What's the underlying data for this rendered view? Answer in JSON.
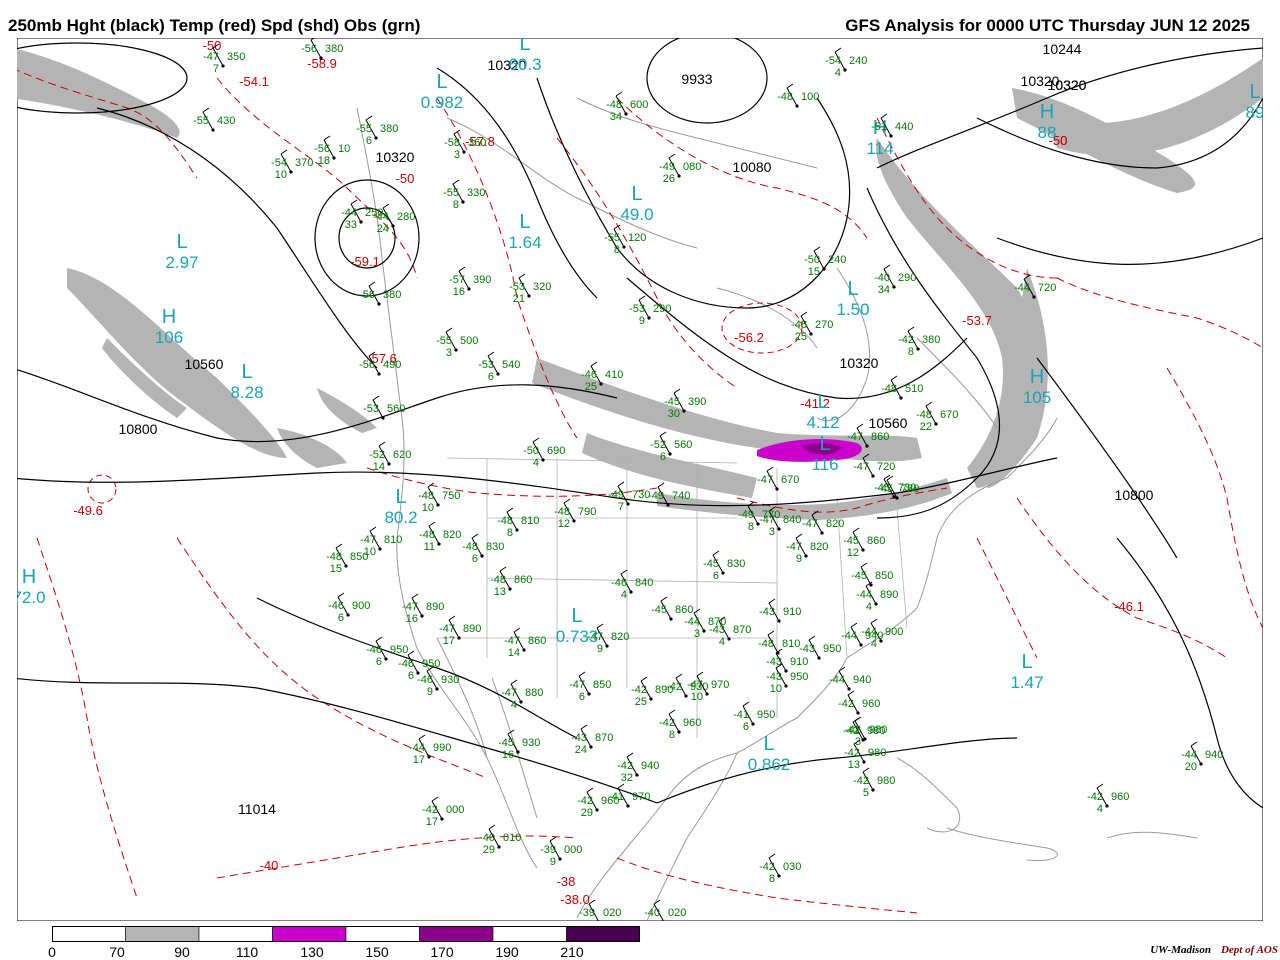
{
  "header": {
    "left_title": "250mb Hght (black) Temp (red) Spd (shd) Obs (grn)",
    "right_title": "GFS Analysis for 0000 UTC Thursday  JUN 12 2025"
  },
  "credit": {
    "org": "UW-Madison",
    "dept": "Dept of AOS"
  },
  "colors": {
    "height": "#000000",
    "temp": "#cc0000",
    "speed_70": "#b4b4b4",
    "speed_110": "#cc00cc",
    "speed_150": "#8a008a",
    "speed_190": "#4a0050",
    "obs": "#007a00",
    "center": "#1aa3b8"
  },
  "colorbar": {
    "ticks": [
      "0",
      "70",
      "90",
      "110",
      "130",
      "150",
      "170",
      "190",
      "210"
    ],
    "bins": [
      {
        "from": 0,
        "to": 70,
        "color": "#ffffff"
      },
      {
        "from": 70,
        "to": 90,
        "color": "#b4b4b4"
      },
      {
        "from": 90,
        "to": 110,
        "color": "#ffffff"
      },
      {
        "from": 110,
        "to": 130,
        "color": "#cc00cc"
      },
      {
        "from": 130,
        "to": 150,
        "color": "#ffffff"
      },
      {
        "from": 150,
        "to": 170,
        "color": "#8a008a"
      },
      {
        "from": 170,
        "to": 190,
        "color": "#ffffff"
      },
      {
        "from": 190,
        "to": 210,
        "color": "#4a0050"
      }
    ]
  },
  "height_labels": [
    "10320",
    "10320",
    "10080",
    "10320",
    "10560",
    "10800",
    "10560",
    "10800",
    "10320",
    "10244",
    "10320",
    "10320",
    "11014",
    "9933"
  ],
  "temp_labels": [
    "-50",
    "-58.9",
    "-57.8",
    "-50",
    "-59.1",
    "-57.6",
    "-54.1",
    "-56.2",
    "-41.2",
    "-49.6",
    "-46.1",
    "-40",
    "-38",
    "-50",
    "-50",
    "-53.7",
    "-38.0"
  ],
  "centers": [
    {
      "type": "L",
      "value": "0.982"
    },
    {
      "type": "L",
      "value": "1.64"
    },
    {
      "type": "L",
      "value": "2.97"
    },
    {
      "type": "H",
      "value": "106"
    },
    {
      "type": "L",
      "value": "8.28"
    },
    {
      "type": "L",
      "value": "1.50"
    },
    {
      "type": "H",
      "value": "114"
    },
    {
      "type": "L",
      "value": "0.733"
    },
    {
      "type": "L",
      "value": "0.862"
    },
    {
      "type": "L",
      "value": "1.47"
    },
    {
      "type": "H",
      "value": "72.0"
    },
    {
      "type": "L",
      "value": "80.2"
    },
    {
      "type": "H",
      "value": "105"
    },
    {
      "type": "L",
      "value": "60.3"
    },
    {
      "type": "L",
      "value": "49.0"
    },
    {
      "type": "H",
      "value": "88"
    },
    {
      "type": "L",
      "value": "89"
    },
    {
      "type": "L",
      "value": "116"
    },
    {
      "type": "L",
      "value": "4.12"
    }
  ],
  "observations": [
    {
      "t": "-47",
      "h": "350",
      "d": "7"
    },
    {
      "t": "-56",
      "h": "380",
      "d": ""
    },
    {
      "t": "-55",
      "h": "430",
      "d": ""
    },
    {
      "t": "-55",
      "h": "380",
      "d": "6"
    },
    {
      "t": "-56",
      "h": "10",
      "d": "18"
    },
    {
      "t": "-54",
      "h": "370",
      "d": "10"
    },
    {
      "t": "-58",
      "h": "360",
      "d": "3"
    },
    {
      "t": "-55",
      "h": "330",
      "d": "8"
    },
    {
      "t": "-44",
      "h": "250",
      "d": "33"
    },
    {
      "t": "-44",
      "h": "280",
      "d": "24"
    },
    {
      "t": "-56",
      "h": "380",
      "d": ""
    },
    {
      "t": "-57",
      "h": "390",
      "d": "16"
    },
    {
      "t": "-53",
      "h": "320",
      "d": "21"
    },
    {
      "t": "-55",
      "h": "500",
      "d": "3"
    },
    {
      "t": "-56",
      "h": "490",
      "d": ""
    },
    {
      "t": "-53",
      "h": "540",
      "d": "6"
    },
    {
      "t": "-53",
      "h": "560",
      "d": ""
    },
    {
      "t": "-52",
      "h": "620",
      "d": "14"
    },
    {
      "t": "-48",
      "h": "600",
      "d": "34"
    },
    {
      "t": "-49",
      "h": "080",
      "d": "26"
    },
    {
      "t": "-55",
      "h": "120",
      "d": "8"
    },
    {
      "t": "-53",
      "h": "290",
      "d": "9"
    },
    {
      "t": "-48",
      "h": "270",
      "d": "25"
    },
    {
      "t": "-50",
      "h": "240",
      "d": "15"
    },
    {
      "t": "-40",
      "h": "290",
      "d": "34"
    },
    {
      "t": "-44",
      "h": "720",
      "d": ""
    },
    {
      "t": "-42",
      "h": "380",
      "d": "8"
    },
    {
      "t": "-48",
      "h": "510",
      "d": ""
    },
    {
      "t": "-48",
      "h": "670",
      "d": "22"
    },
    {
      "t": "-54",
      "h": "240",
      "d": "4"
    },
    {
      "t": "-51",
      "h": "440",
      "d": ""
    },
    {
      "t": "-48",
      "h": "100",
      "d": ""
    },
    {
      "t": "-46",
      "h": "410",
      "d": "25"
    },
    {
      "t": "-45",
      "h": "390",
      "d": "30"
    },
    {
      "t": "-52",
      "h": "560",
      "d": "6"
    },
    {
      "t": "-50",
      "h": "690",
      "d": "4"
    },
    {
      "t": "-48",
      "h": "750",
      "d": "10"
    },
    {
      "t": "-48",
      "h": "810",
      "d": "8"
    },
    {
      "t": "-48",
      "h": "790",
      "d": "12"
    },
    {
      "t": "-49",
      "h": "730",
      "d": "7"
    },
    {
      "t": "-49",
      "h": "740",
      "d": ""
    },
    {
      "t": "-47",
      "h": "810",
      "d": "10"
    },
    {
      "t": "-48",
      "h": "820",
      "d": "11"
    },
    {
      "t": "-48",
      "h": "830",
      "d": "6"
    },
    {
      "t": "-48",
      "h": "850",
      "d": "15"
    },
    {
      "t": "-48",
      "h": "860",
      "d": "13"
    },
    {
      "t": "-46",
      "h": "900",
      "d": "6"
    },
    {
      "t": "-47",
      "h": "890",
      "d": "16"
    },
    {
      "t": "-47",
      "h": "890",
      "d": "17"
    },
    {
      "t": "-46",
      "h": "950",
      "d": "6"
    },
    {
      "t": "-46",
      "h": "950",
      "d": "6"
    },
    {
      "t": "-46",
      "h": "930",
      "d": "9"
    },
    {
      "t": "-47",
      "h": "860",
      "d": "14"
    },
    {
      "t": "-47",
      "h": "880",
      "d": "4"
    },
    {
      "t": "-47",
      "h": "850",
      "d": "6"
    },
    {
      "t": "-47",
      "h": "820",
      "d": "9"
    },
    {
      "t": "-46",
      "h": "840",
      "d": "4"
    },
    {
      "t": "-45",
      "h": "860",
      "d": ""
    },
    {
      "t": "-44",
      "h": "870",
      "d": "3"
    },
    {
      "t": "-43",
      "h": "870",
      "d": "4"
    },
    {
      "t": "-42",
      "h": "890",
      "d": "25"
    },
    {
      "t": "-42",
      "h": "930",
      "d": ""
    },
    {
      "t": "-43",
      "h": "910",
      "d": ""
    },
    {
      "t": "-45",
      "h": "830",
      "d": "6"
    },
    {
      "t": "-47",
      "h": "840",
      "d": "3"
    },
    {
      "t": "-47",
      "h": "820",
      "d": "9"
    },
    {
      "t": "-48",
      "h": "810",
      "d": ""
    },
    {
      "t": "-43",
      "h": "910",
      "d": ""
    },
    {
      "t": "-43",
      "h": "950",
      "d": "10"
    },
    {
      "t": "-43",
      "h": "950",
      "d": ""
    },
    {
      "t": "-42",
      "h": "960",
      "d": "8"
    },
    {
      "t": "-41",
      "h": "950",
      "d": "6"
    },
    {
      "t": "-47",
      "h": "970",
      "d": "10"
    },
    {
      "t": "-44",
      "h": "940",
      "d": ""
    },
    {
      "t": "-42",
      "h": "960",
      "d": ""
    },
    {
      "t": "-42",
      "h": "980",
      "d": ""
    },
    {
      "t": "-42",
      "h": "980",
      "d": "3"
    },
    {
      "t": "-42",
      "h": "980",
      "d": "13"
    },
    {
      "t": "-42",
      "h": "980",
      "d": "5"
    },
    {
      "t": "-44",
      "h": "940",
      "d": "20"
    },
    {
      "t": "-42",
      "h": "960",
      "d": "4"
    },
    {
      "t": "-44",
      "h": "990",
      "d": "17"
    },
    {
      "t": "-45",
      "h": "930",
      "d": "16"
    },
    {
      "t": "-43",
      "h": "870",
      "d": "24"
    },
    {
      "t": "-42",
      "h": "940",
      "d": "32"
    },
    {
      "t": "-42",
      "h": "960",
      "d": "29"
    },
    {
      "t": "-41",
      "h": "970",
      "d": ""
    },
    {
      "t": "-42",
      "h": "000",
      "d": "17"
    },
    {
      "t": "-40",
      "h": "010",
      "d": "29"
    },
    {
      "t": "-39",
      "h": "000",
      "d": "9"
    },
    {
      "t": "-39",
      "h": "020",
      "d": ""
    },
    {
      "t": "-40",
      "h": "020",
      "d": ""
    },
    {
      "t": "-42",
      "h": "030",
      "d": "8"
    },
    {
      "t": "-45",
      "h": "780",
      "d": ""
    },
    {
      "t": "-47",
      "h": "720",
      "d": ""
    },
    {
      "t": "-47",
      "h": "860",
      "d": ""
    },
    {
      "t": "-45",
      "h": "730",
      "d": ""
    },
    {
      "t": "-47",
      "h": "820",
      "d": ""
    },
    {
      "t": "-45",
      "h": "860",
      "d": "12"
    },
    {
      "t": "-45",
      "h": "850",
      "d": ""
    },
    {
      "t": "-44",
      "h": "890",
      "d": "4"
    },
    {
      "t": "-44",
      "h": "900",
      "d": "4"
    },
    {
      "t": "-44",
      "h": "940",
      "d": ""
    },
    {
      "t": "-49",
      "h": "770",
      "d": "8"
    },
    {
      "t": "-47",
      "h": "670",
      "d": ""
    }
  ]
}
